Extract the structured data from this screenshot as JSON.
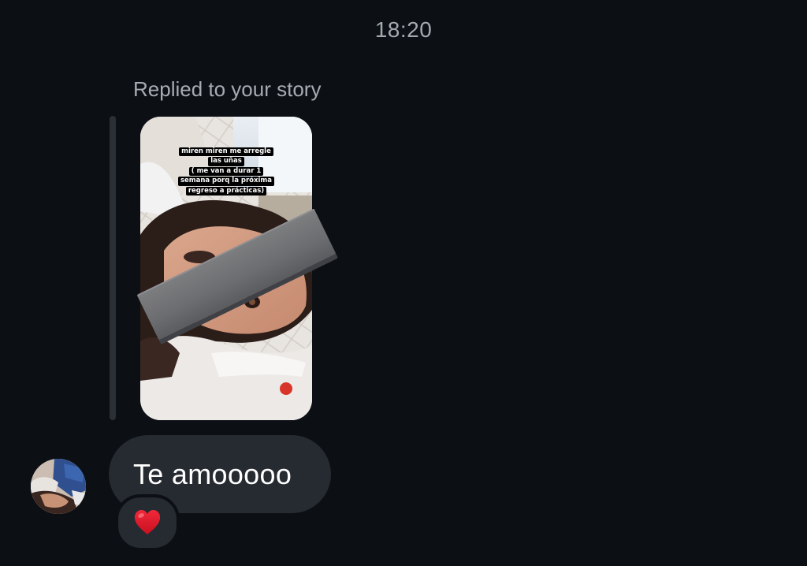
{
  "conversation": {
    "timestamp": "18:20",
    "reply_context": "Replied to your story",
    "story": {
      "caption_lines": [
        "miren miren me arregle",
        "las uñas",
        "( me van a durar 1",
        "semana porq la próxima",
        "regreso a prácticas)"
      ]
    },
    "message": {
      "text": "Te amooooo"
    },
    "reaction": {
      "icon": "red-heart-icon",
      "color": "#e0142a"
    }
  }
}
